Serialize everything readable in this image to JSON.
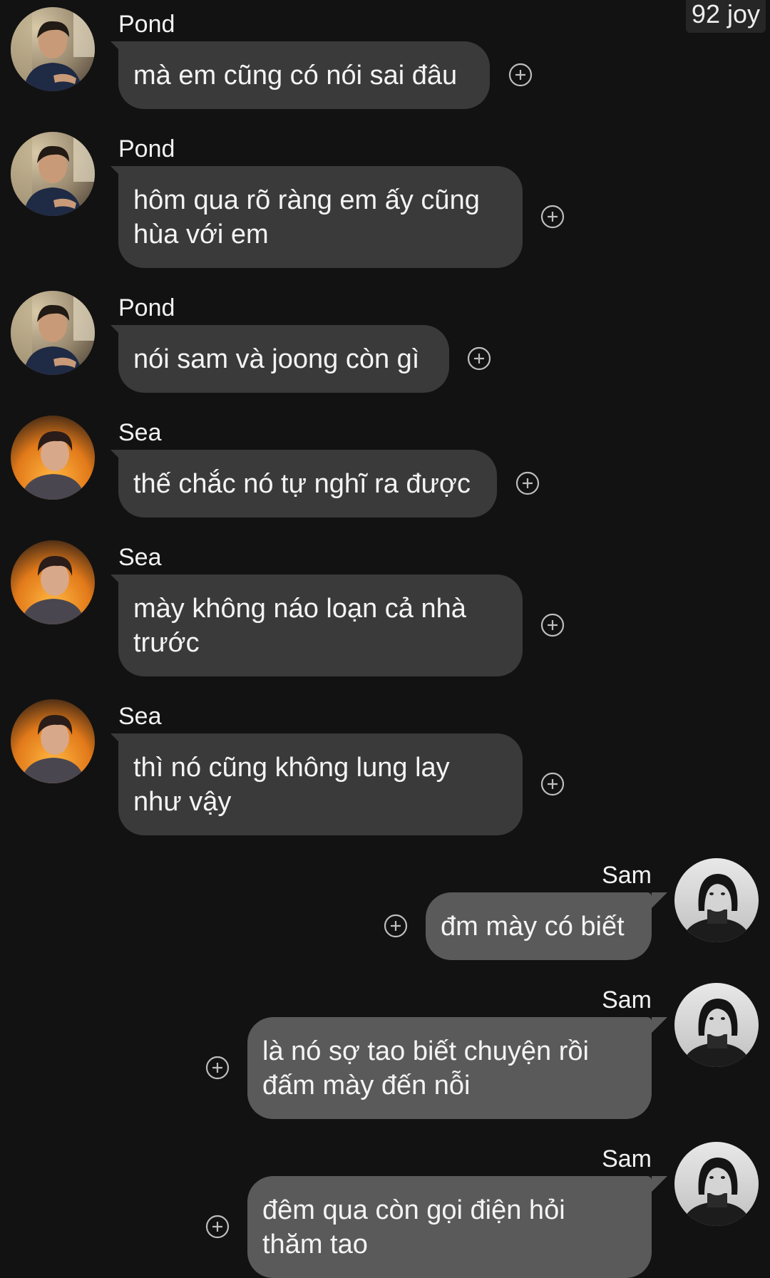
{
  "watermark": "92 joy",
  "icons": {
    "react": "add-reaction-icon",
    "avatar_pond": "avatar-pond",
    "avatar_sea": "avatar-sea",
    "avatar_sam": "avatar-sam"
  },
  "colors": {
    "background": "#121212",
    "incoming_bubble": "#3a3a3a",
    "outgoing_bubble": "#5a5a5a"
  },
  "messages": [
    {
      "sender": "Pond",
      "side": "left",
      "text": "mà em cũng có nói sai đâu"
    },
    {
      "sender": "Pond",
      "side": "left",
      "line1": "hôm qua rõ ràng em ấy cũng",
      "line2": "hùa với em"
    },
    {
      "sender": "Pond",
      "side": "left",
      "text": "nói sam và joong còn gì"
    },
    {
      "sender": "Sea",
      "side": "left",
      "text": "thế chắc nó tự nghĩ ra được"
    },
    {
      "sender": "Sea",
      "side": "left",
      "line1": "mày không náo loạn cả nhà",
      "line2": "trước"
    },
    {
      "sender": "Sea",
      "side": "left",
      "line1": "thì nó cũng không lung lay",
      "line2": "như vậy"
    },
    {
      "sender": "Sam",
      "side": "right",
      "text": "đm mày có biết"
    },
    {
      "sender": "Sam",
      "side": "right",
      "line1": "là nó sợ tao biết chuyện rồi",
      "line2": "đấm mày đến nỗi"
    },
    {
      "sender": "Sam",
      "side": "right",
      "line1": "đêm qua còn gọi điện hỏi",
      "line2": "thăm tao"
    }
  ]
}
